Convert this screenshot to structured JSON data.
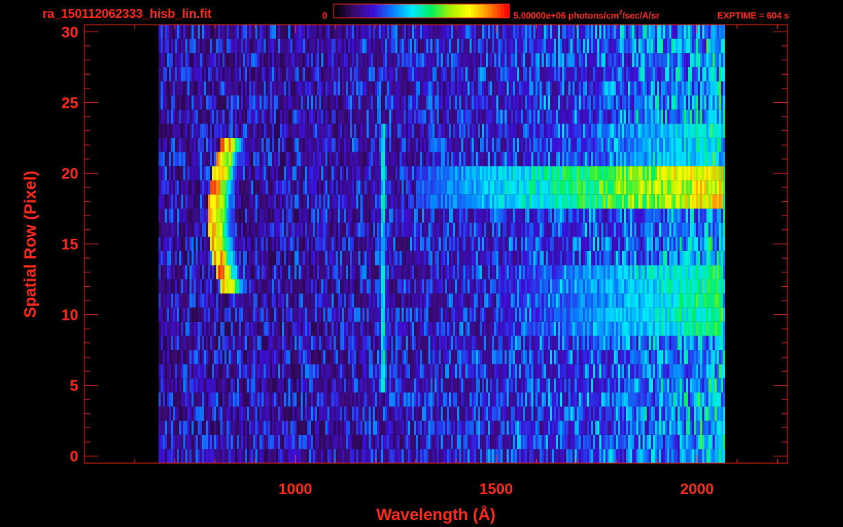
{
  "header": {
    "filename": "ra_150112062333_hisb_lin.fit",
    "colorbar_min": "0",
    "colorbar_max": "5.00000e+06",
    "units_pre": " photons/cm",
    "units_sup": "2",
    "units_post": "/sec/A/sr",
    "exptime": "EXPTIME = 604 s"
  },
  "colors": {
    "axis": "#ff2a1a",
    "background": "#000000",
    "colormap": [
      "#000000",
      "#3a0a6e",
      "#3b0fd8",
      "#0a7cff",
      "#00e8ff",
      "#00f060",
      "#a6f000",
      "#ffff00",
      "#ff8800",
      "#ff0000"
    ]
  },
  "chart_data": {
    "type": "heatmap",
    "title": "",
    "xlabel": "Wavelength (Å)",
    "ylabel": "Spatial Row (Pixel)",
    "xlim": [
      475,
      2225
    ],
    "ylim": [
      -0.5,
      30.5
    ],
    "xticks": [
      1000,
      1500,
      2000
    ],
    "xtick_labels": [
      "1000",
      "1500",
      "2000"
    ],
    "xminor_ticks": [
      600,
      700,
      800,
      900,
      1100,
      1200,
      1300,
      1400,
      1600,
      1700,
      1800,
      1900,
      2100,
      2200
    ],
    "yticks": [
      0,
      5,
      10,
      15,
      20,
      25,
      30
    ],
    "ytick_labels": [
      "0",
      "5",
      "10",
      "15",
      "20",
      "25",
      "30"
    ],
    "colorbar": {
      "min": 0,
      "max": 5000000,
      "label": "photons/cm^2/sec/A/sr"
    },
    "rows_range": [
      0,
      30
    ],
    "data_extent_wavelength": [
      655,
      2065
    ],
    "features": [
      {
        "kind": "arc",
        "name": "Lyman arc",
        "rows": [
          12,
          22
        ],
        "wavelength_center": 830,
        "peak_fraction": 0.95
      },
      {
        "kind": "line",
        "name": "Lyman-alpha line",
        "rows": [
          5,
          23
        ],
        "wavelength": 1216,
        "peak_fraction": 0.6
      },
      {
        "kind": "faint_line",
        "wavelength": 1026,
        "rows": [
          10,
          22
        ],
        "peak_fraction": 0.2
      },
      {
        "kind": "band",
        "rows": [
          18,
          20
        ],
        "wavelength_range": [
          1300,
          2060
        ],
        "peak_fraction": 0.85
      },
      {
        "kind": "band",
        "rows": [
          9,
          13
        ],
        "wavelength_range": [
          1500,
          2060
        ],
        "peak_fraction": 0.58
      },
      {
        "kind": "band",
        "rows": [
          20,
          23
        ],
        "wavelength_range": [
          1600,
          2050
        ],
        "peak_fraction": 0.5
      }
    ]
  }
}
